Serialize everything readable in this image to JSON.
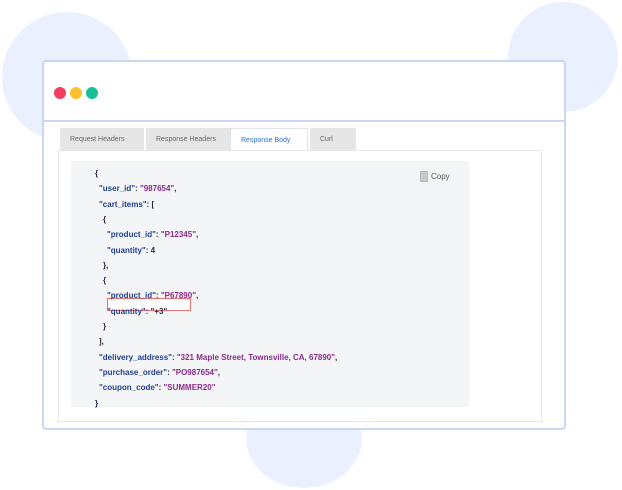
{
  "window": {
    "colors": {
      "red": "#f23d5c",
      "yellow": "#fbc02d",
      "green": "#16c096",
      "border": "#c9d6f5"
    }
  },
  "tabs": [
    {
      "label": "Request Headers",
      "active": false
    },
    {
      "label": "Response Headers",
      "active": false
    },
    {
      "label": "Response Body",
      "active": true
    },
    {
      "label": "Curl",
      "active": false
    }
  ],
  "copy_label": "Copy",
  "json_lines": [
    {
      "indent": 0,
      "parts": [
        {
          "t": "{",
          "c": "p"
        }
      ]
    },
    {
      "indent": 1,
      "parts": [
        {
          "t": "\"user_id\"",
          "c": "k"
        },
        {
          "t": ": ",
          "c": "p"
        },
        {
          "t": "\"987654\"",
          "c": "s"
        },
        {
          "t": ",",
          "c": "p"
        }
      ]
    },
    {
      "indent": 1,
      "parts": [
        {
          "t": "\"cart_items\"",
          "c": "k"
        },
        {
          "t": ": [",
          "c": "p"
        }
      ]
    },
    {
      "indent": 2,
      "parts": [
        {
          "t": "{",
          "c": "p"
        }
      ]
    },
    {
      "indent": 3,
      "parts": [
        {
          "t": "\"product_id\"",
          "c": "k"
        },
        {
          "t": ": ",
          "c": "p"
        },
        {
          "t": "\"P12345\"",
          "c": "s"
        },
        {
          "t": ",",
          "c": "p"
        }
      ]
    },
    {
      "indent": 3,
      "parts": [
        {
          "t": "\"quantity\"",
          "c": "k"
        },
        {
          "t": ": ",
          "c": "p"
        },
        {
          "t": "4",
          "c": "n"
        }
      ]
    },
    {
      "indent": 2,
      "parts": [
        {
          "t": "},",
          "c": "p"
        }
      ]
    },
    {
      "indent": 2,
      "parts": [
        {
          "t": "{",
          "c": "p"
        }
      ]
    },
    {
      "indent": 3,
      "parts": [
        {
          "t": "\"product_id\"",
          "c": "k"
        },
        {
          "t": ": ",
          "c": "p"
        },
        {
          "t": "\"P67890\"",
          "c": "s"
        },
        {
          "t": ",",
          "c": "p"
        }
      ]
    },
    {
      "indent": 3,
      "parts": [
        {
          "t": "\"quantity\"",
          "c": "k"
        },
        {
          "t": ": ",
          "c": "p"
        },
        {
          "t": "\"+3\"",
          "c": "n"
        }
      ],
      "highlight": true
    },
    {
      "indent": 2,
      "parts": [
        {
          "t": "}",
          "c": "p"
        }
      ]
    },
    {
      "indent": 1,
      "parts": [
        {
          "t": "],",
          "c": "p"
        }
      ]
    },
    {
      "indent": 1,
      "parts": [
        {
          "t": "\"delivery_address\"",
          "c": "k"
        },
        {
          "t": ": ",
          "c": "p"
        },
        {
          "t": "\"321 Maple Street, Townsville, CA, 67890\"",
          "c": "s"
        },
        {
          "t": ",",
          "c": "p"
        }
      ]
    },
    {
      "indent": 1,
      "parts": [
        {
          "t": "\"purchase_order\"",
          "c": "k"
        },
        {
          "t": ": ",
          "c": "p"
        },
        {
          "t": "\"PO987654\"",
          "c": "s"
        },
        {
          "t": ",",
          "c": "p"
        }
      ]
    },
    {
      "indent": 1,
      "parts": [
        {
          "t": "\"coupon_code\"",
          "c": "k"
        },
        {
          "t": ": ",
          "c": "p"
        },
        {
          "t": "\"SUMMER20\"",
          "c": "s"
        }
      ]
    },
    {
      "indent": 0,
      "parts": [
        {
          "t": "}",
          "c": "p"
        }
      ]
    }
  ]
}
